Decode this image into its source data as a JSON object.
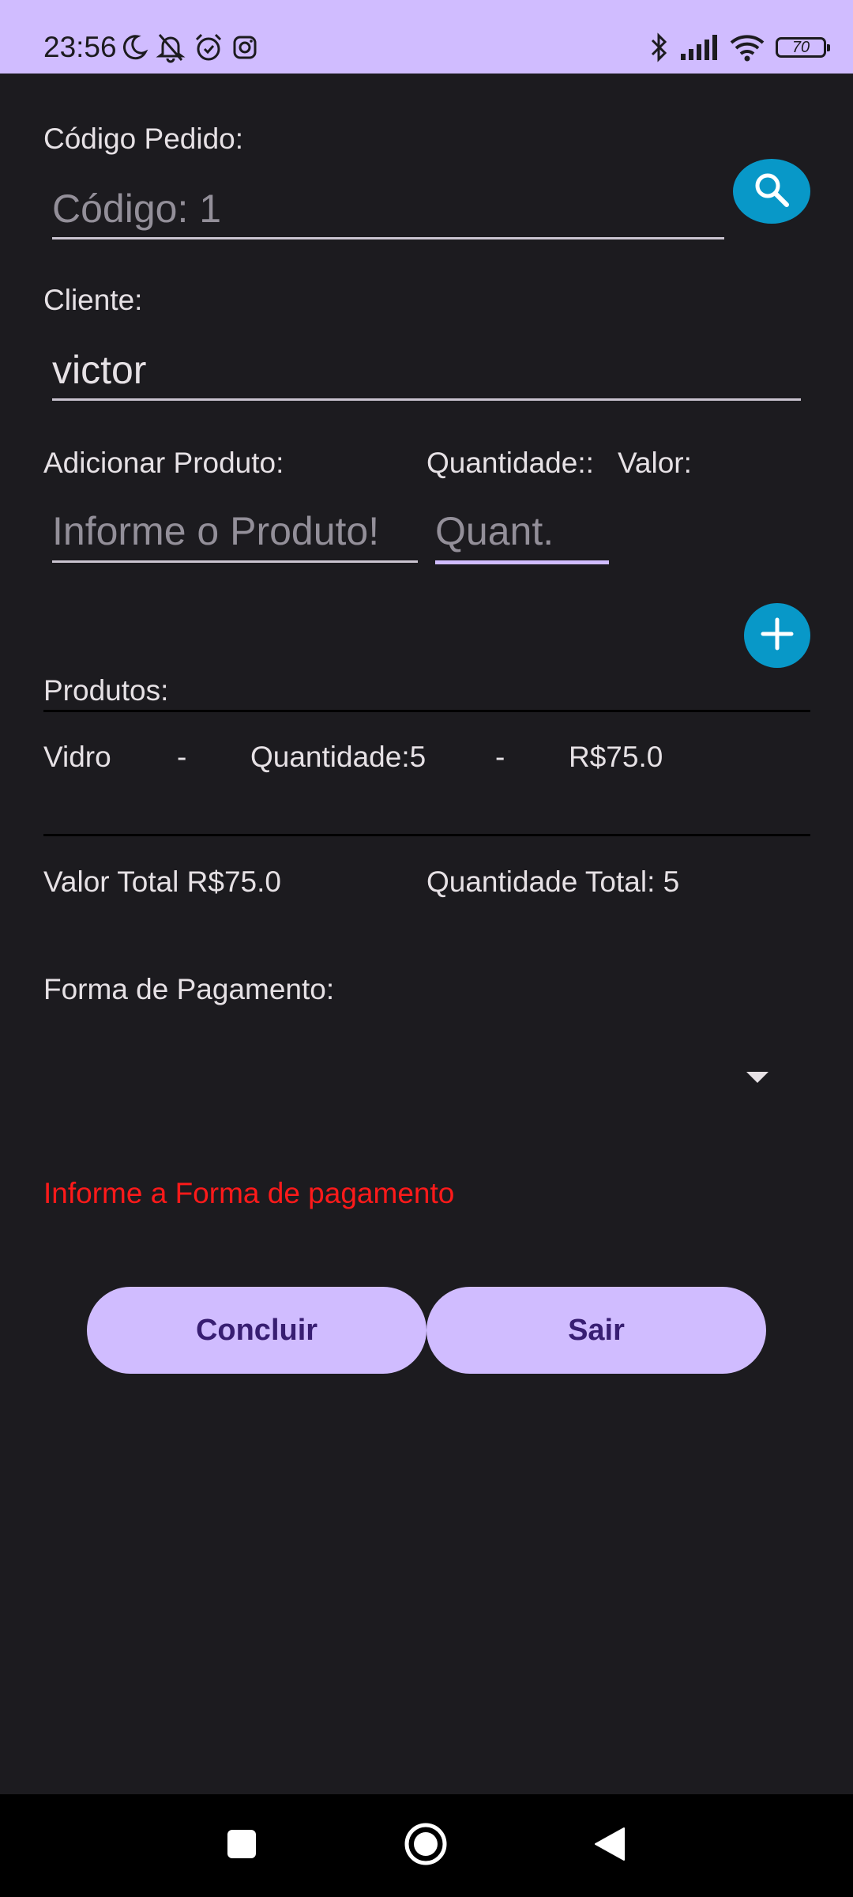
{
  "status_bar": {
    "time": "23:56",
    "battery_level": "70",
    "icons_left": [
      "moon-icon",
      "bell-off-icon",
      "alarm-icon",
      "instagram-icon"
    ],
    "icons_right": [
      "bluetooth-icon",
      "signal-icon",
      "wifi-icon",
      "battery-icon"
    ]
  },
  "order": {
    "code_label": "Código Pedido:",
    "code_placeholder": "Código: 1",
    "client_label": "Cliente:",
    "client_value": "victor"
  },
  "add_product": {
    "product_label": "Adicionar Produto:",
    "quantity_label": "Quantidade::",
    "value_label": "Valor:",
    "product_placeholder": "Informe o Produto!",
    "quantity_placeholder": "Quant."
  },
  "products": {
    "label": "Produtos:",
    "items": [
      {
        "name": "Vidro",
        "sep1": "-",
        "quantity": "Quantidade:5",
        "sep2": "-",
        "price": "R$75.0"
      }
    ]
  },
  "totals": {
    "total_value": "Valor Total R$75.0",
    "total_quantity": "Quantidade Total: 5"
  },
  "payment": {
    "label": "Forma de Pagamento:",
    "selected": "",
    "error": "Informe a Forma de pagamento"
  },
  "actions": {
    "conclude_label": "Concluir",
    "exit_label": "Sair"
  },
  "colors": {
    "background": "#1c1b1f",
    "status_bar": "#d0bcff",
    "accent_fab": "#0898c8",
    "button_bg": "#d0bcff",
    "button_text": "#381e72",
    "error": "#ff1a1a"
  }
}
